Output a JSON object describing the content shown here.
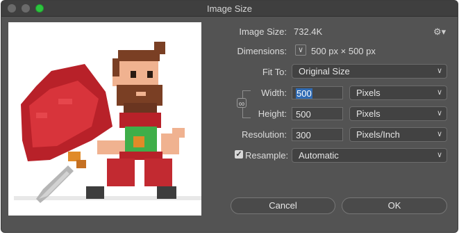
{
  "window": {
    "title": "Image Size"
  },
  "info": {
    "image_size_label": "Image Size:",
    "image_size_value": "732.4K",
    "dimensions_label": "Dimensions:",
    "dimensions_value": "500 px  ×  500 px"
  },
  "fit_to": {
    "label": "Fit To:",
    "value": "Original Size"
  },
  "width": {
    "label": "Width:",
    "value": "500",
    "unit": "Pixels"
  },
  "height": {
    "label": "Height:",
    "value": "500",
    "unit": "Pixels"
  },
  "resolution": {
    "label": "Resolution:",
    "value": "300",
    "unit": "Pixels/Inch"
  },
  "resample": {
    "label": "Resample:",
    "checked": true,
    "value": "Automatic"
  },
  "buttons": {
    "cancel": "Cancel",
    "ok": "OK"
  },
  "icons": {
    "gear": "gear-icon",
    "link": "chain-link-icon",
    "dropdown": "chevron-down-icon"
  },
  "colors": {
    "window_bg": "#535353",
    "selection": "#2f6bb4",
    "zoom_button": "#2dc43f"
  }
}
